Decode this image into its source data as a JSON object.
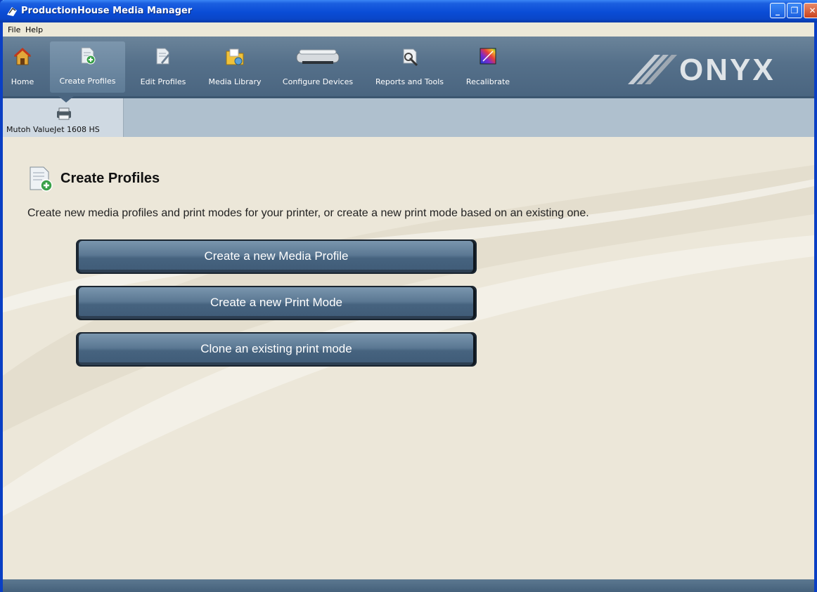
{
  "window": {
    "title": "ProductionHouse Media Manager"
  },
  "menu": {
    "file": "File",
    "help": "Help"
  },
  "toolbar": {
    "items": [
      {
        "label": "Home",
        "icon": "home-icon"
      },
      {
        "label": "Create Profiles",
        "icon": "create-profile-icon"
      },
      {
        "label": "Edit Profiles",
        "icon": "edit-profile-icon"
      },
      {
        "label": "Media Library",
        "icon": "media-library-icon"
      },
      {
        "label": "Configure Devices",
        "icon": "printer-icon"
      },
      {
        "label": "Reports and Tools",
        "icon": "reports-icon"
      },
      {
        "label": "Recalibrate",
        "icon": "recalibrate-icon"
      }
    ],
    "active": "Create Profiles"
  },
  "brand": {
    "logo": "ONYX"
  },
  "device": {
    "label": "Mutoh ValueJet 1608 HS"
  },
  "page": {
    "title": "Create Profiles",
    "description": "Create new media profiles and print modes for your printer, or create a new print mode based on an existing one.",
    "buttons": {
      "media_profile": "Create a new Media Profile",
      "print_mode": "Create a new Print Mode",
      "clone": "Clone an existing print mode"
    }
  },
  "colors": {
    "toolbar": "#55708a",
    "content_bg": "#ece7d9",
    "button": "#4f6c88",
    "titlebar": "#0a4cd6"
  }
}
